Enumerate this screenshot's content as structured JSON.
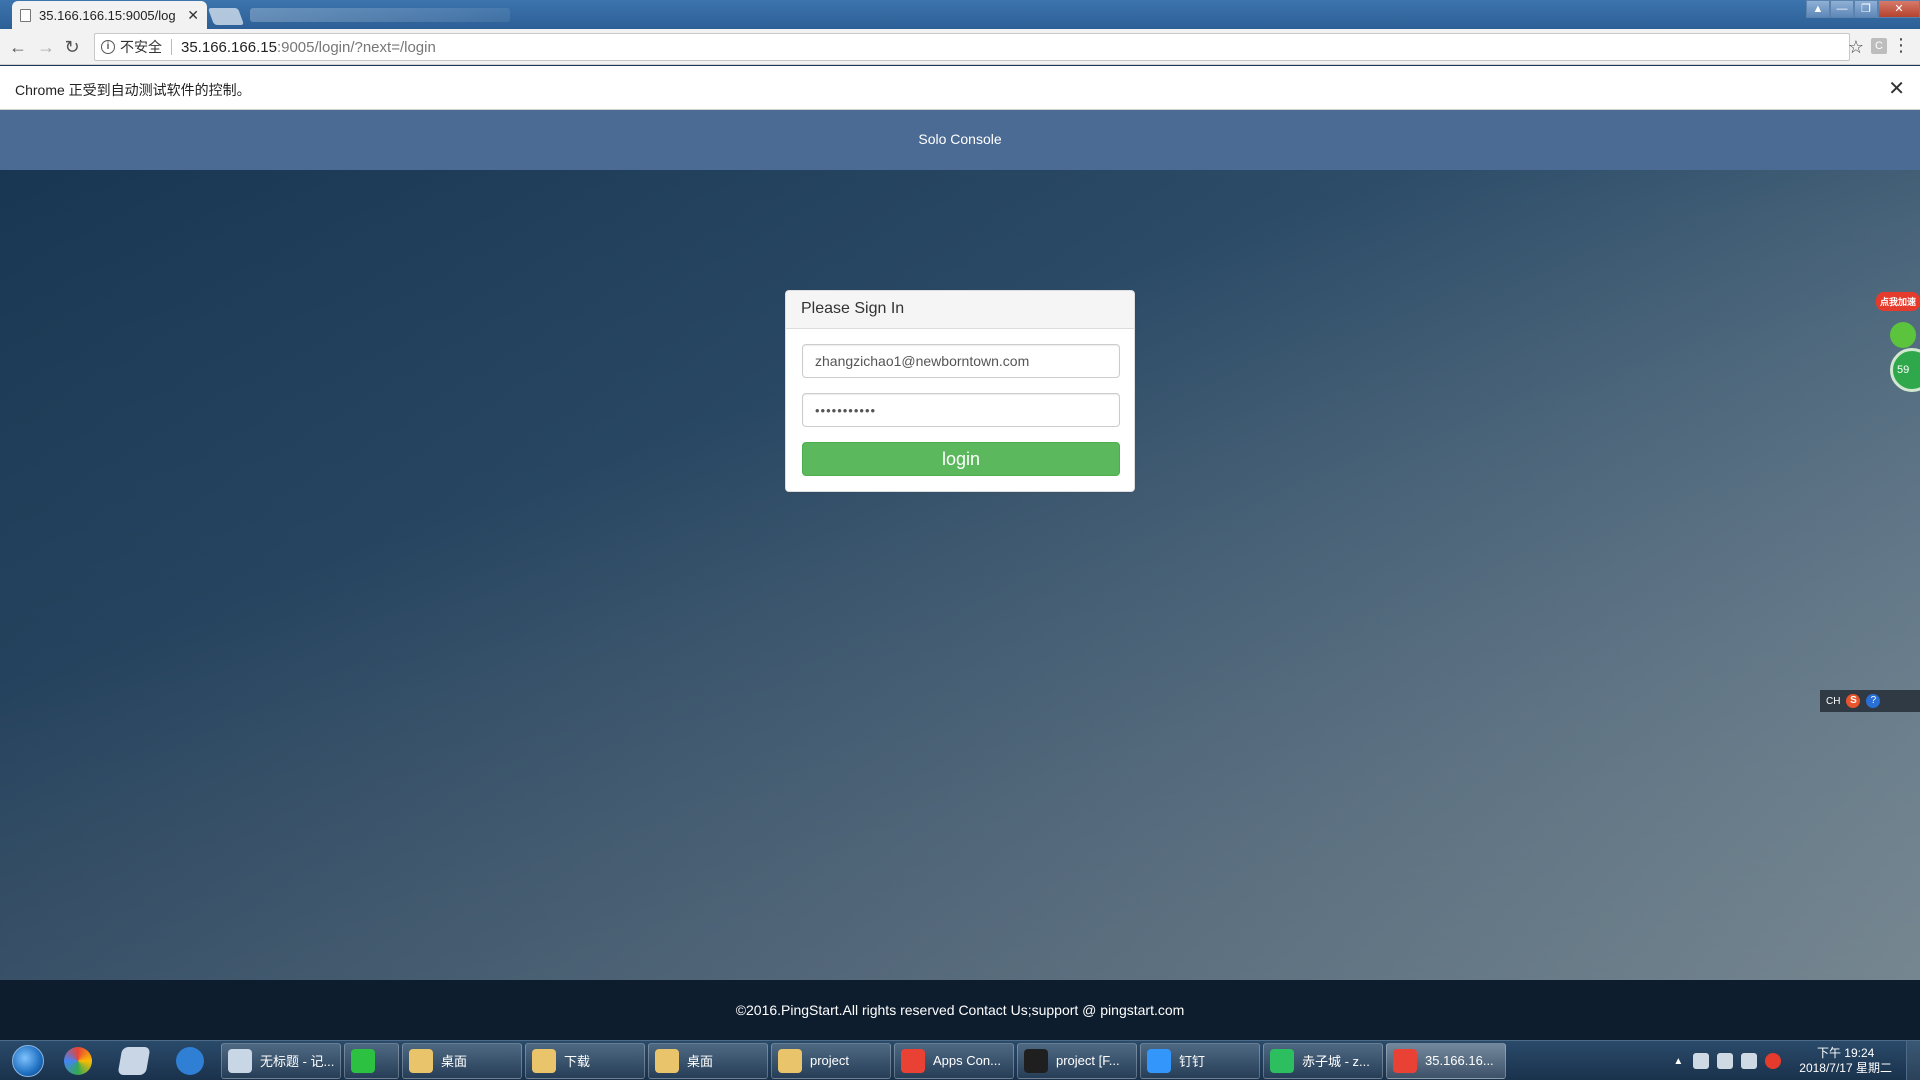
{
  "browser": {
    "tab_title": "35.166.166.15:9005/log",
    "tab_close": "✕",
    "window_buttons": [
      "▲",
      "—",
      "❐",
      "✕"
    ],
    "not_secure": "不安全",
    "url_host": "35.166.166.15",
    "url_path": ":9005/login/?next=/login",
    "extension_label": "C"
  },
  "infobar": {
    "message": "Chrome 正受到自动测试软件的控制。",
    "close": "✕"
  },
  "page": {
    "brand": "Solo Console",
    "panel_title": "Please Sign In",
    "email_value": "zhangzichao1@newborntown.com",
    "password_value": "•••••••••••",
    "login_label": "login",
    "footer": "©2016.PingStart.All rights reserved Contact Us;support @ pingstart.com"
  },
  "widgets": {
    "accelerate_badge": "点我加速",
    "ball_value": "59",
    "ime_lang": "CH",
    "ime_s": "S",
    "ime_help": "?"
  },
  "taskbar": {
    "tasks": [
      {
        "label": "无标题 - 记...",
        "color": "#c9d6e6"
      },
      {
        "label": "",
        "color": "#2cc140"
      },
      {
        "label": "桌面",
        "color": "#e9c46a"
      },
      {
        "label": "下载",
        "color": "#e9c46a"
      },
      {
        "label": "桌面",
        "color": "#e9c46a"
      },
      {
        "label": "project",
        "color": "#e9c46a"
      },
      {
        "label": "Apps Con...",
        "color": "#e94235"
      },
      {
        "label": "project [F...",
        "color": "#1f1f1f"
      },
      {
        "label": "钉钉",
        "color": "#3296fa"
      },
      {
        "label": "赤子城 - z...",
        "color": "#2dbe60"
      },
      {
        "label": "35.166.16...",
        "color": "#e94235"
      }
    ],
    "clock_time": "下午 19:24",
    "clock_date": "2018/7/17 星期二"
  }
}
